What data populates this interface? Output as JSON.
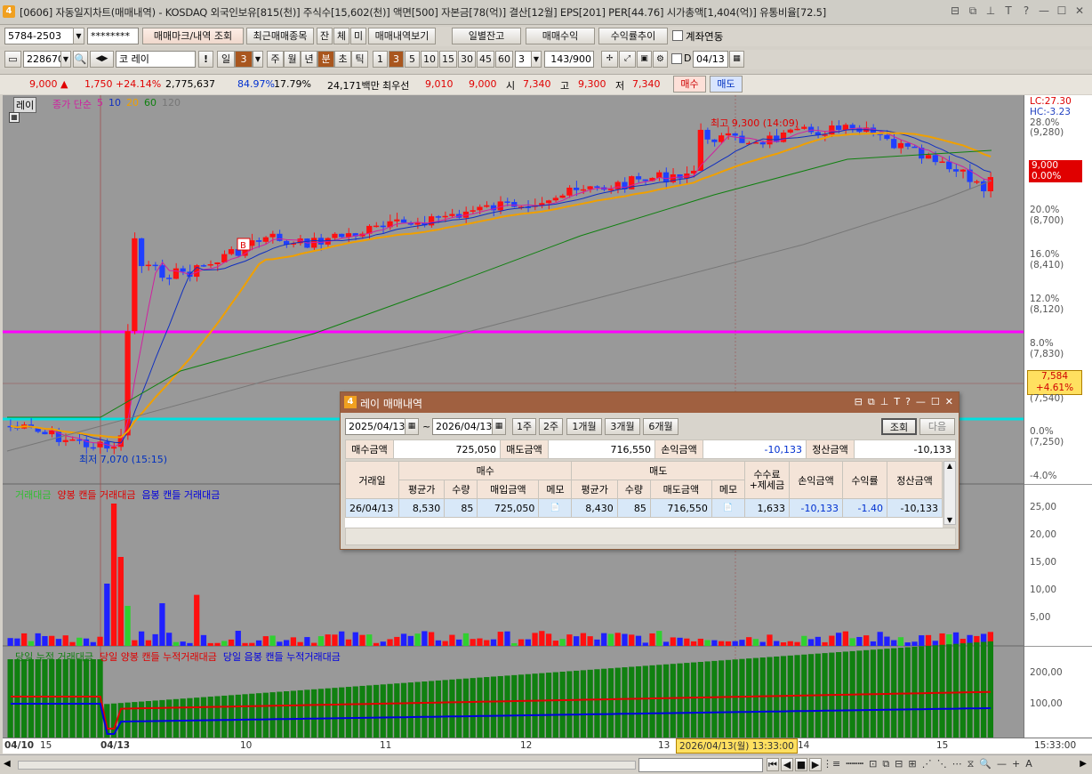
{
  "window": {
    "app_num": "4",
    "title": "[0606] 자동일지차트(매매내역) - KOSDAQ 외국인보유[815(천)] 주식수[15,602(천)] 액면[500] 자본금[78(억)] 결산[12월] EPS[201] PER[44.76] 시가총액[1,404(억)] 유통비율[72.5]",
    "controls": [
      "⊟",
      "⧉",
      "⊥",
      "T",
      "?",
      "—",
      "☐",
      "✕"
    ]
  },
  "toolbar1": {
    "account": "5784-2503",
    "password": "********",
    "btn_trade_mark": "매매마크/내역 조회",
    "btn_recent": "최근매매종목",
    "btn_jan": "잔",
    "btn_che": "체",
    "btn_mi": "미",
    "btn_trade_view": "매매내역보기",
    "btn_daily_balance": "일별잔고",
    "btn_trade_profit": "매매수익",
    "btn_yield_trend": "수익률추이",
    "account_link_label": "계좌연동"
  },
  "toolbar2": {
    "code": "228670",
    "name": "코 레이",
    "bang": "!",
    "periods": [
      "일",
      "3",
      "주",
      "월",
      "년",
      "분",
      "초",
      "틱"
    ],
    "selected_period": "분",
    "intervals": [
      "1",
      "3",
      "5",
      "10",
      "15",
      "30",
      "45",
      "60"
    ],
    "interval_input": "3",
    "count": "143",
    "total": "/900",
    "date_input": "04/13",
    "d_label": "D"
  },
  "pricebar": {
    "price": "9,000",
    "arrow": "▲",
    "change": "1,750",
    "change_pct": "+24.14%",
    "volume": "2,775,637",
    "vol_ratio": "84.97%",
    "turnover": "17.79%",
    "amount": "24,171백만",
    "pref_label": "최우선",
    "ask": "9,010",
    "bid": "9,000",
    "open_label": "시",
    "open": "7,340",
    "high_label": "고",
    "high": "9,300",
    "low_label": "저",
    "low": "7,340",
    "buy_btn": "매수",
    "sell_btn": "매도"
  },
  "chart": {
    "name_tag": "레이",
    "ma_legend_title": "종가 단순",
    "ma_periods": [
      "5",
      "10",
      "20",
      "60",
      "120"
    ],
    "high_annotation": "최고 9,300 (14:09)",
    "low_annotation": "최저 7,070 (15:15)",
    "lc_label": "LC:27.30",
    "hc_label": "HC:-3.23",
    "current_price_tag": "9,000",
    "current_pct_tag": "0.00%",
    "cursor_price": "7,584",
    "cursor_pct": "+4.61%",
    "right_axis": [
      {
        "pct": "28.0%",
        "price": "(9,280)"
      },
      {
        "pct": "20.0%",
        "price": "(8,700)"
      },
      {
        "pct": "16.0%",
        "price": "(8,410)"
      },
      {
        "pct": "12.0%",
        "price": "(8,120)"
      },
      {
        "pct": "8.0%",
        "price": "(7,830)"
      },
      {
        "pct": "4.0%",
        "price": "(7,540)"
      },
      {
        "pct": "0.0%",
        "price": "(7,250)"
      },
      {
        "pct": "-4.0%",
        "price": ""
      }
    ],
    "volume_legend": [
      "거래대금",
      "양봉 캔들 거래대금",
      "음봉 캔들 거래대금"
    ],
    "volume_axis": [
      "25,00",
      "20,00",
      "15,00",
      "10,00",
      "5,00"
    ],
    "cum_legend": [
      "당일 누적 거래대금",
      "당일 양봉 캔들 누적거래대금",
      "당일 음봉 캔들 누적거래대금"
    ],
    "cum_axis": [
      "200,00",
      "100,00"
    ],
    "x_labels": [
      "04/10",
      "15",
      "04/13",
      "10",
      "11",
      "12",
      "13",
      "14",
      "15"
    ],
    "cursor_time": "2026/04/13(월) 13:33:00",
    "axis_time": "15:33:00"
  },
  "dialog": {
    "num": "4",
    "title": "레이 매매내역",
    "controls": [
      "⊟",
      "⧉",
      "⊥",
      "T",
      "?",
      "—",
      "☐",
      "✕"
    ],
    "date_from": "2025/04/13",
    "tilde": "~",
    "date_to": "2026/04/13",
    "range_buttons": [
      "1주",
      "2주",
      "1개월",
      "3개월",
      "6개월"
    ],
    "btn_query": "조회",
    "btn_next": "다음",
    "summary": {
      "buy_amt_label": "매수금액",
      "buy_amt": "725,050",
      "sell_amt_label": "매도금액",
      "sell_amt": "716,550",
      "pl_label": "손익금액",
      "pl": "-10,133",
      "settle_label": "정산금액",
      "settle": "-10,133"
    },
    "headers": {
      "date": "거래일",
      "buy": "매수",
      "sell": "매도",
      "fee1": "수수료",
      "fee2": "+제세금",
      "pl": "손익금액",
      "yield": "수익률",
      "settle": "정산금액",
      "sub": [
        "평균가",
        "수량",
        "매입금액",
        "메모",
        "평균가",
        "수량",
        "매도금액",
        "메모"
      ]
    },
    "rows": [
      {
        "date": "26/04/13",
        "buy_avg": "8,530",
        "buy_qty": "85",
        "buy_amt": "725,050",
        "sell_avg": "8,430",
        "sell_qty": "85",
        "sell_amt": "716,550",
        "fee": "1,633",
        "pl": "-10,133",
        "yield": "-1.40",
        "settle": "-10,133"
      }
    ]
  }
}
